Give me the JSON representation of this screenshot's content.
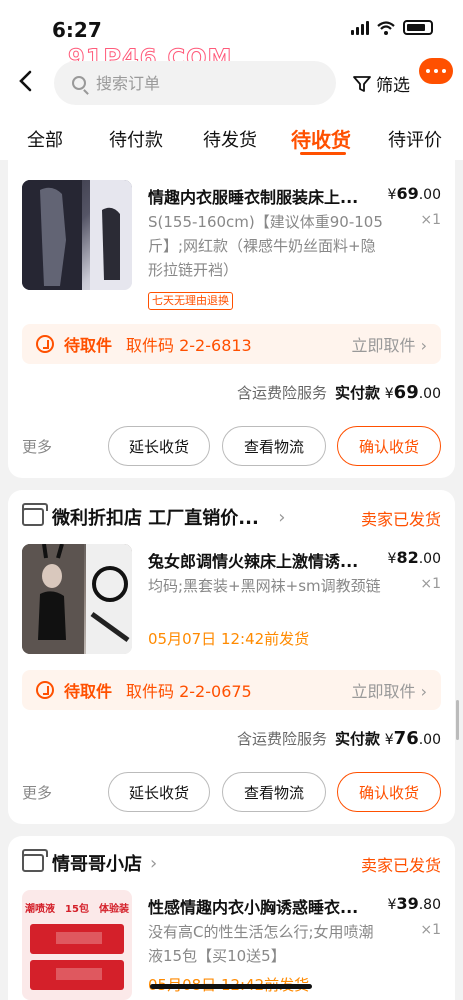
{
  "status_bar": {
    "time": "6:27"
  },
  "watermark": "91P46.COM",
  "header": {
    "back_icon": "chevron-left-icon",
    "search_placeholder": "搜索订单",
    "filter_label": "筛选",
    "more_icon": "more-dots-icon"
  },
  "tabs": [
    {
      "label": "全部",
      "active": false
    },
    {
      "label": "待付款",
      "active": false
    },
    {
      "label": "待发货",
      "active": false
    },
    {
      "label": "待收货",
      "active": true
    },
    {
      "label": "待评价",
      "active": false
    }
  ],
  "orders": [
    {
      "product_title": "情趣内衣服睡衣制服装床上...",
      "price_symbol": "¥",
      "price": "69",
      "price_dec": ".00",
      "spec": "S(155-160cm)【建议体重90-105斤】;网红款（裸感牛奶丝面料+隐形拉链开裆）",
      "qty": "×1",
      "tag": "七天无理由退换",
      "pickup_label": "待取件",
      "pickup_code": "取件码 2-2-6813",
      "pickup_action": "立即取件",
      "total_prefix": "含运费险服务",
      "total_label": "实付款",
      "total_amount": "69",
      "total_dec": ".00",
      "more": "更多",
      "btn_extend": "延长收货",
      "btn_logistics": "查看物流",
      "btn_confirm": "确认收货"
    },
    {
      "shop_name": "微利折扣店 工厂直销价...",
      "shop_status": "卖家已发货",
      "product_title": "兔女郎调情火辣床上激情诱...",
      "price_symbol": "¥",
      "price": "82",
      "price_dec": ".00",
      "spec": "均码;黑套装+黑网袜+sm调教颈链",
      "qty": "×1",
      "ship_time": "05月07日 12:42前发货",
      "pickup_label": "待取件",
      "pickup_code": "取件码 2-2-0675",
      "pickup_action": "立即取件",
      "total_prefix": "含运费险服务",
      "total_label": "实付款",
      "total_amount": "76",
      "total_dec": ".00",
      "more": "更多",
      "btn_extend": "延长收货",
      "btn_logistics": "查看物流",
      "btn_confirm": "确认收货"
    },
    {
      "shop_name": "情哥哥小店",
      "shop_status": "卖家已发货",
      "product_title": "性感情趣内衣小胸诱惑睡衣...",
      "price_symbol": "¥",
      "price": "39",
      "price_dec": ".80",
      "spec": "没有高C的性生活怎么行;女用喷潮液15包【买10送5】",
      "qty": "×1",
      "ship_time": "05月08日 12:42前发货",
      "thumb_text": "潮喷液　15包　体验装"
    }
  ],
  "colors": {
    "accent": "#ff5000",
    "ship_orange": "#ff8a00"
  }
}
